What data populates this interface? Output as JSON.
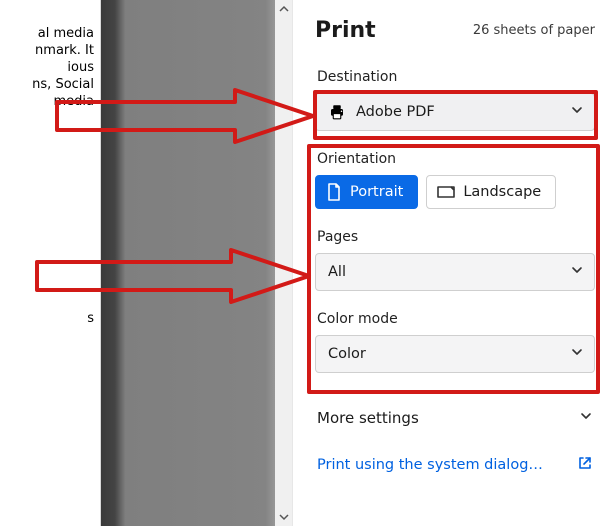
{
  "bg_text": {
    "seg1": "al media\nnmark. It\nious\nns, Social\nmedia",
    "seg2": "s"
  },
  "panel": {
    "title": "Print",
    "sheets_label": "26 sheets of paper"
  },
  "destination": {
    "label": "Destination",
    "value": "Adobe PDF"
  },
  "orientation": {
    "label": "Orientation",
    "portrait": "Portrait",
    "landscape": "Landscape",
    "active": "portrait"
  },
  "pages": {
    "label": "Pages",
    "value": "All"
  },
  "color_mode": {
    "label": "Color mode",
    "value": "Color"
  },
  "more_settings": {
    "label": "More settings"
  },
  "system_dialog": {
    "label": "Print using the system dialog…"
  },
  "icons": {
    "printer": "printer-icon",
    "doc": "doc-icon",
    "chevron_down": "chevron-down-icon",
    "open": "open-external-icon",
    "scroll_up": "scroll-up-icon",
    "scroll_down": "scroll-down-icon"
  },
  "colors": {
    "accent": "#0a6ae6",
    "link": "#0061e0",
    "annotation": "#d21a17"
  }
}
